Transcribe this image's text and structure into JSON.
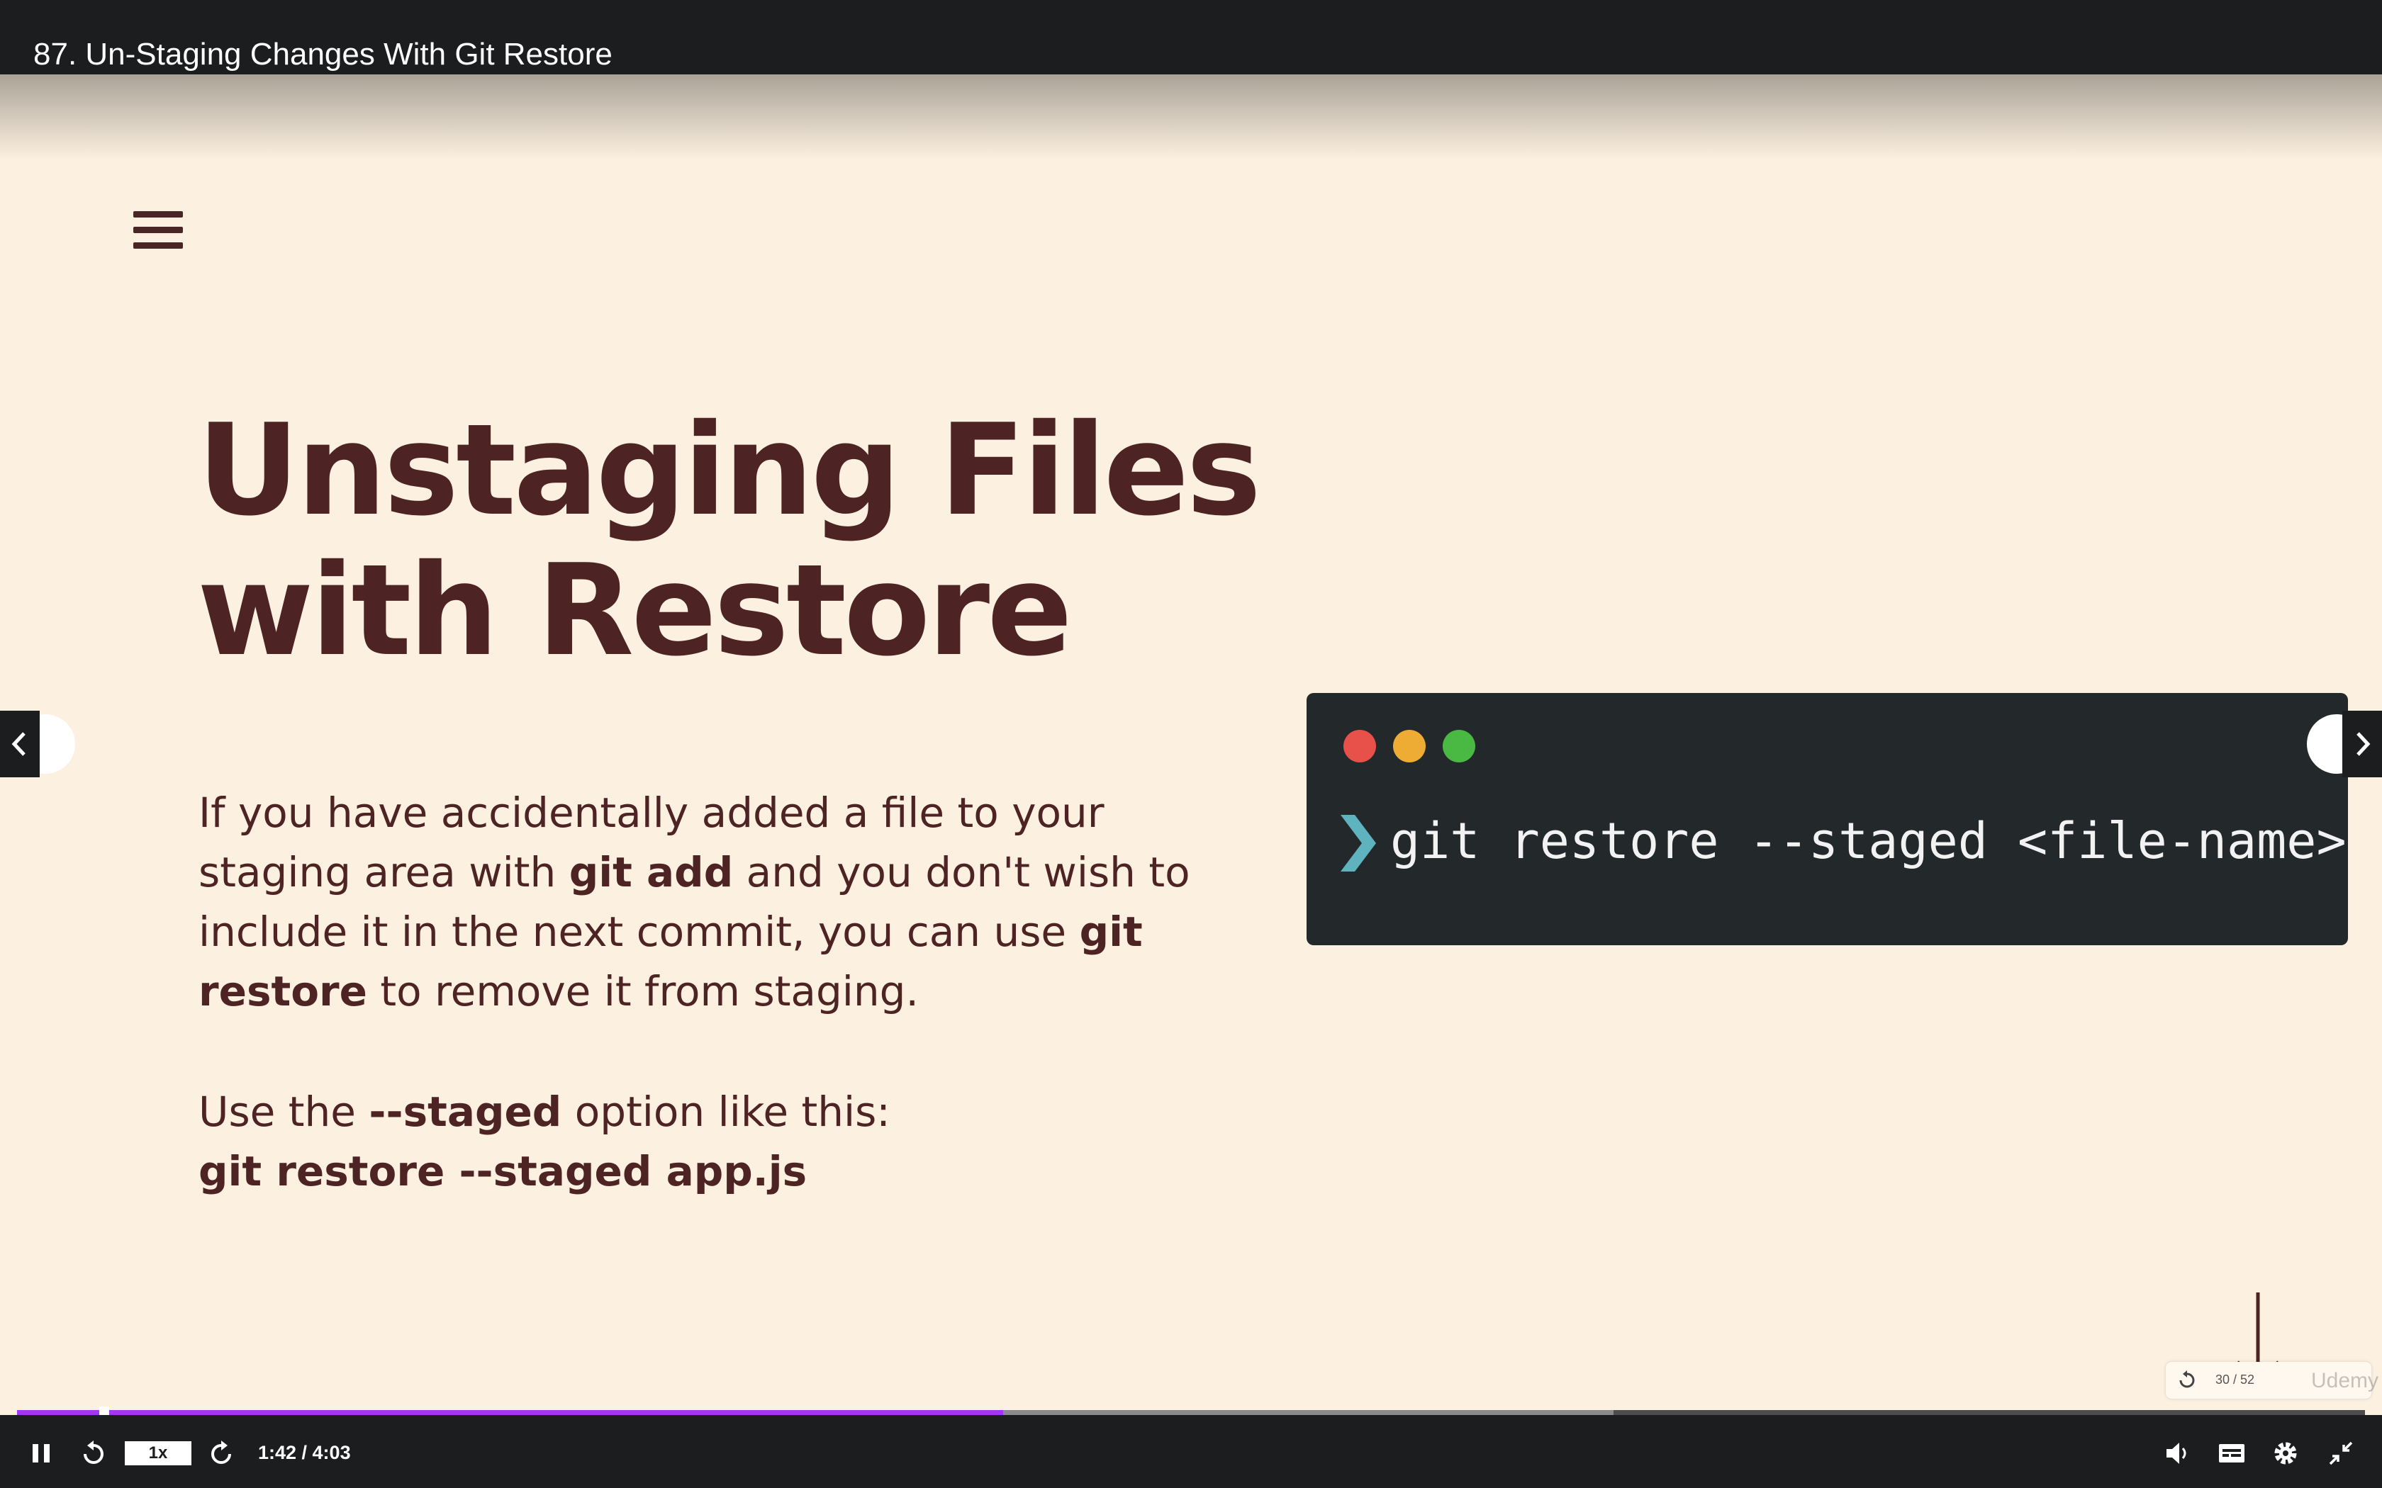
{
  "header": {
    "title": "87. Un-Staging Changes With Git Restore"
  },
  "slide": {
    "heading_line1": "Unstaging Files",
    "heading_line2": "with Restore",
    "para1": {
      "t1": "If you have accidentally added a file to your staging area with ",
      "b1": "git add",
      "t2": " and you don't wish to include it in the next commit, you can use ",
      "b2": "git restore",
      "t3": " to remove it from staging."
    },
    "para2": {
      "t1": "Use the ",
      "b1": "--staged",
      "t2": " option like this:",
      "code": "git restore --staged app.js"
    },
    "terminal": {
      "command": "git restore --staged <file-name>"
    },
    "slide_counter": "30 / 52",
    "watermark": "Udemy"
  },
  "player": {
    "speed": "1x",
    "time": "1:42 / 4:03",
    "progress_fraction": 0.42,
    "buffered_fraction": 0.68,
    "played_color": "#a435f0"
  },
  "icons": [
    "hamburger-menu-icon",
    "chevron-right-icon",
    "down-arrow-icon",
    "pause-icon",
    "rewind-icon",
    "forward-icon",
    "volume-icon",
    "captions-icon",
    "settings-icon",
    "exit-fullscreen-icon",
    "prev-slide-icon",
    "next-slide-icon"
  ]
}
